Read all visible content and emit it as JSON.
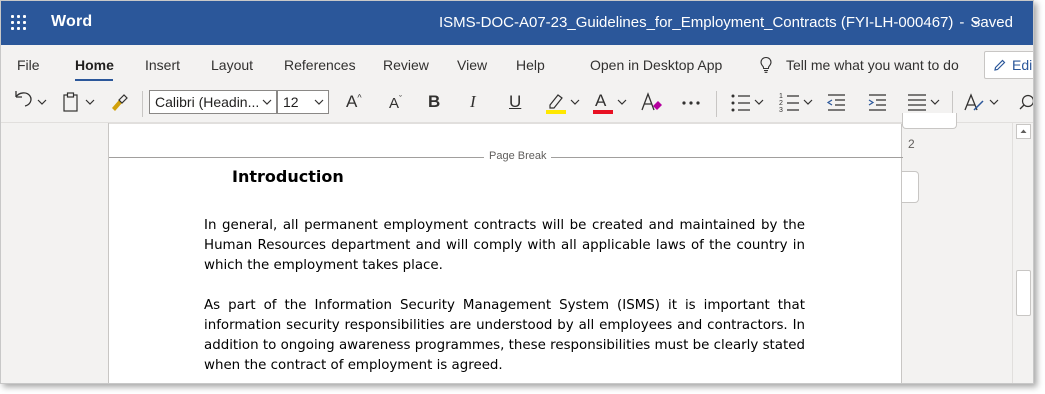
{
  "app": {
    "name": "Word"
  },
  "title": {
    "document": "ISMS-DOC-A07-23_Guidelines_for_Employment_Contracts (FYI-LH-000467)",
    "separator": "-",
    "status": "Saved"
  },
  "tabs": [
    "File",
    "Home",
    "Insert",
    "Layout",
    "References",
    "Review",
    "View",
    "Help",
    "Open in Desktop App"
  ],
  "tell_me": "Tell me what you want to do",
  "edit_button": "Edi",
  "toolbar": {
    "font_name": "Calibri (Headin...",
    "font_size": "12",
    "grow_font": "A",
    "shrink_font": "A",
    "bold": "B",
    "italic": "I",
    "underline": "U",
    "font_color_letter": "A",
    "highlight_color": "#ffe800",
    "font_color": "#e81123"
  },
  "document": {
    "page_break_label": "Page Break",
    "heading": "Introduction",
    "paragraphs": [
      "In general, all permanent employment contracts will be created and maintained by the Human Resources department and will comply with all applicable laws of the country in which the employment takes place.",
      "As part of the Information Security Management System (ISMS) it is important that information security responsibilities are understood by all employees and contractors. In addition to ongoing awareness programmes, these responsibilities must be clearly stated when the contract of employment is agreed."
    ],
    "side_number": "2"
  },
  "colors": {
    "brand": "#2b579a"
  }
}
